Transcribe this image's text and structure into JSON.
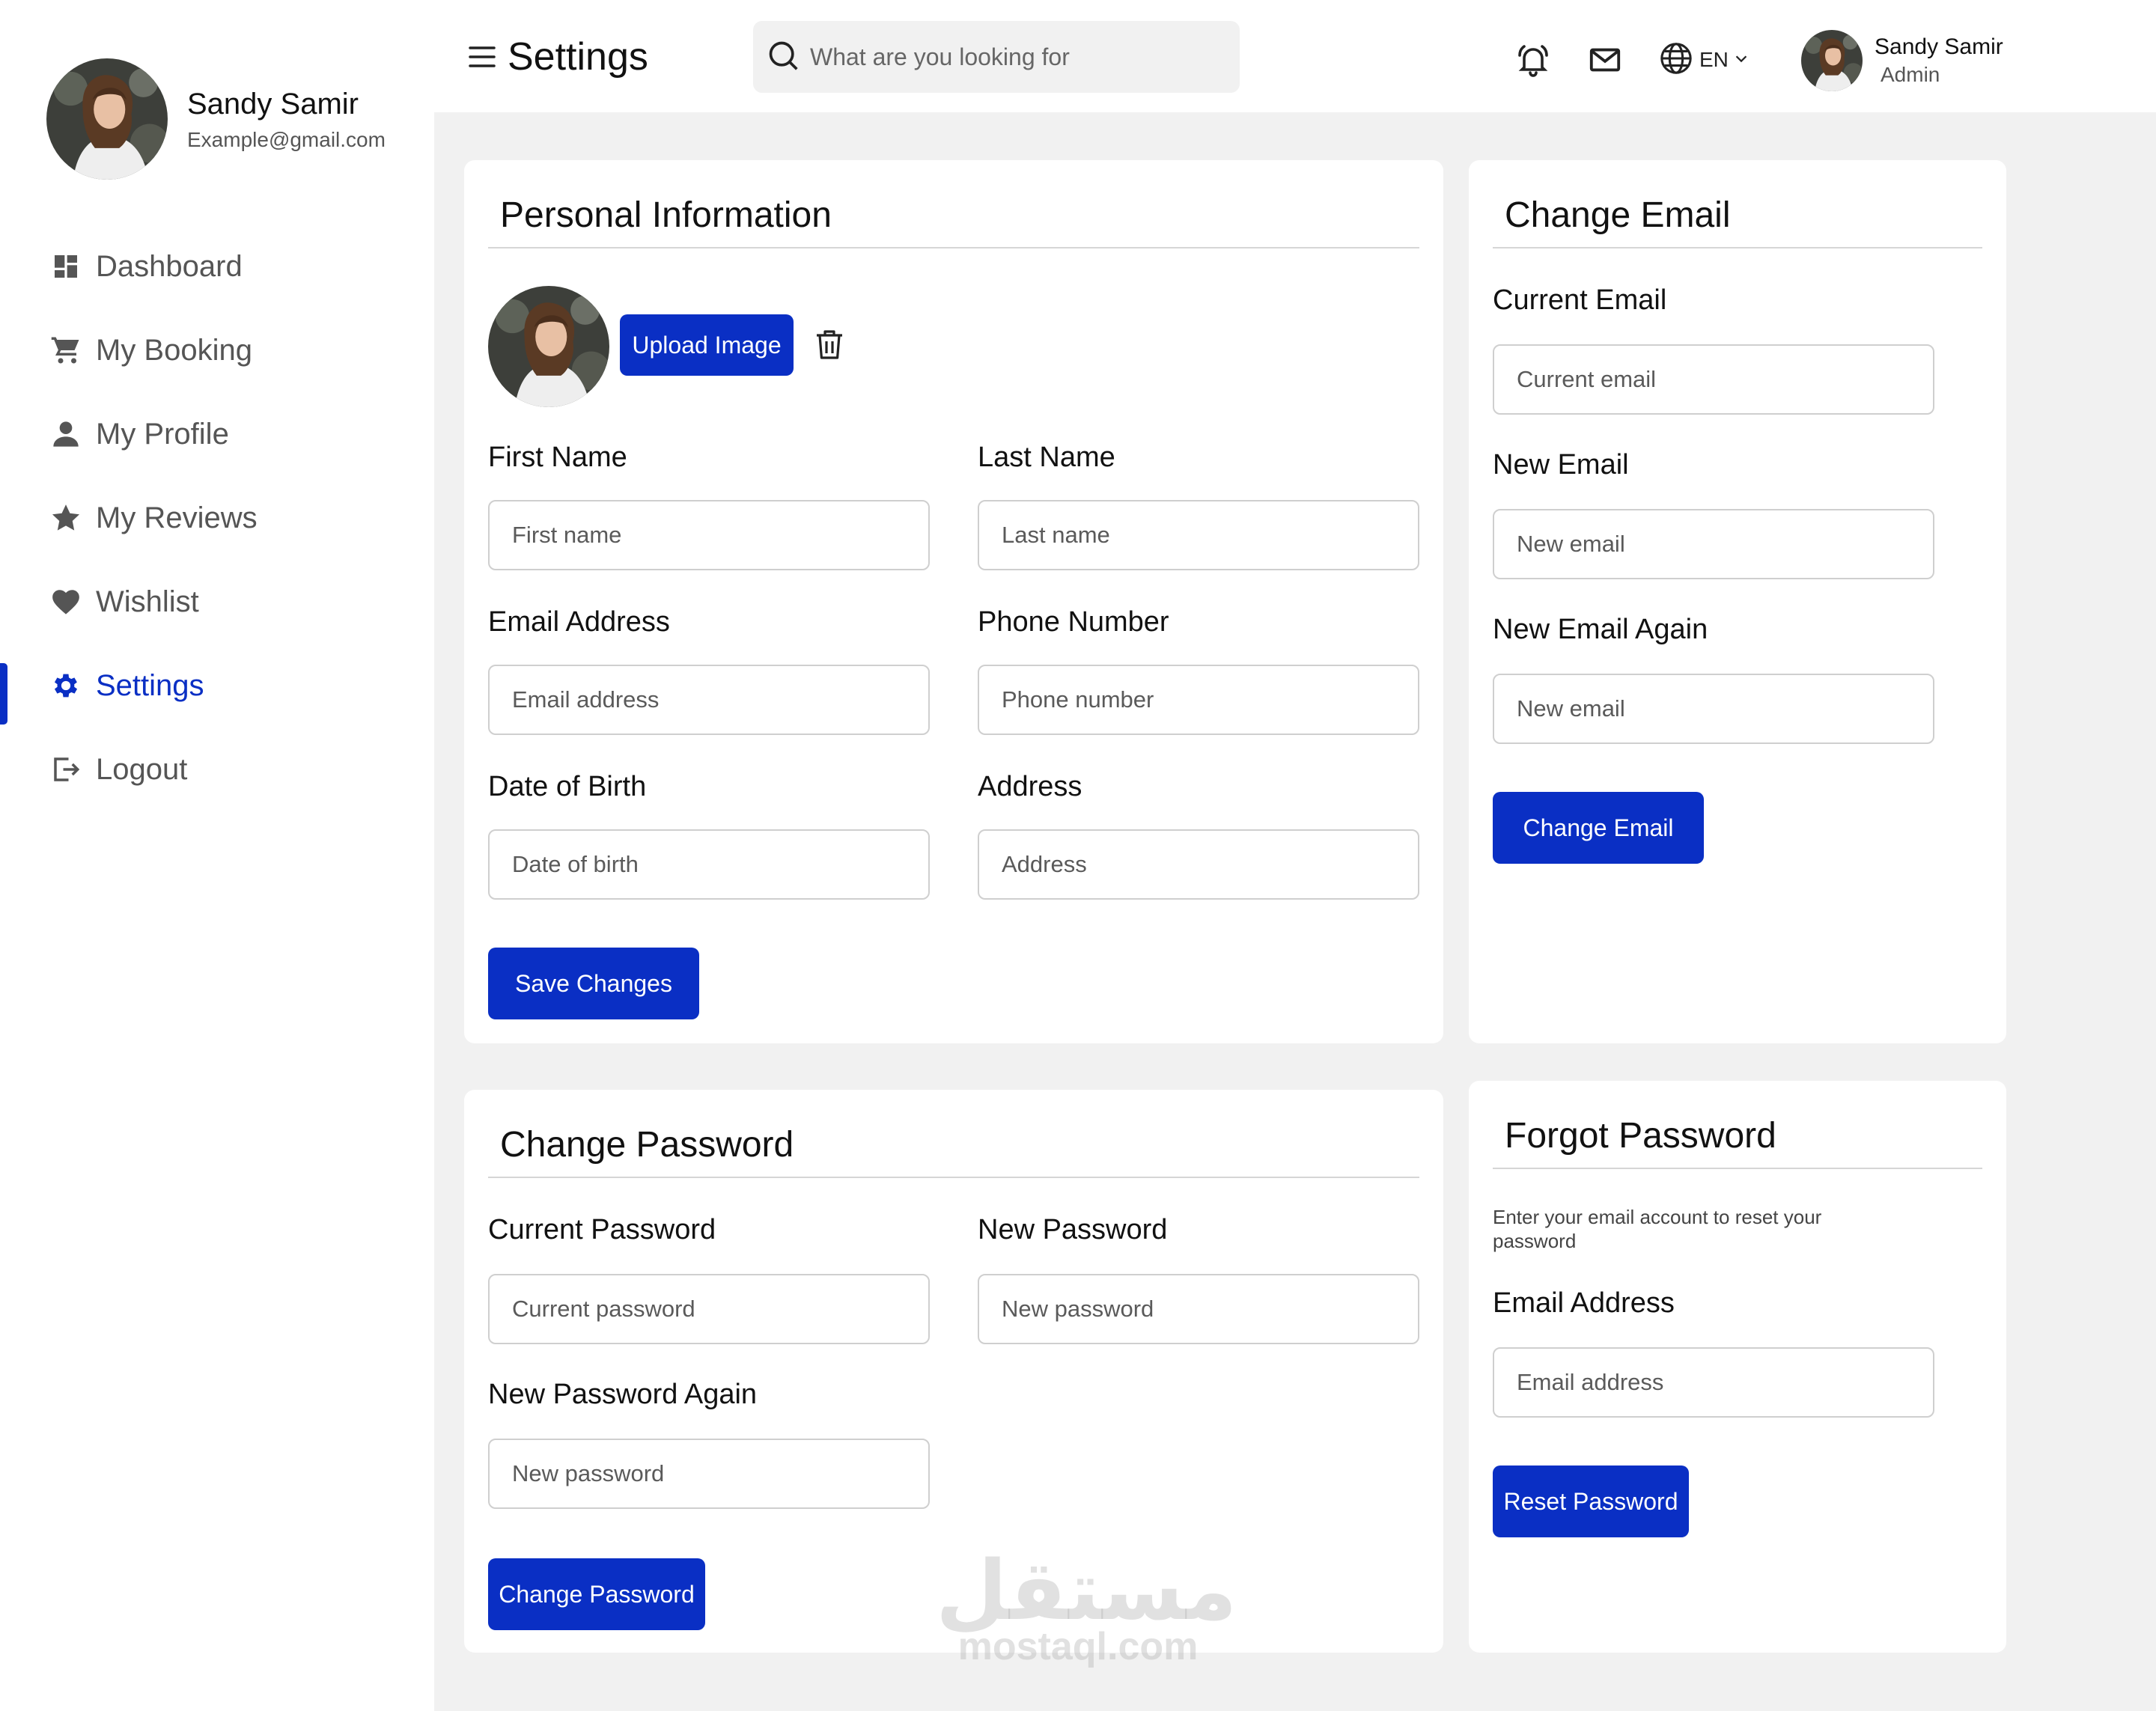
{
  "sidebar": {
    "profile": {
      "name": "Sandy Samir",
      "email": "Example@gmail.com"
    },
    "items": [
      {
        "label": "Dashboard",
        "icon": "dashboard-icon"
      },
      {
        "label": "My Booking",
        "icon": "cart-icon"
      },
      {
        "label": "My Profile",
        "icon": "user-icon"
      },
      {
        "label": "My Reviews",
        "icon": "star-icon"
      },
      {
        "label": "Wishlist",
        "icon": "heart-icon"
      },
      {
        "label": "Settings",
        "icon": "gear-icon",
        "active": true
      },
      {
        "label": "Logout",
        "icon": "logout-icon"
      }
    ]
  },
  "header": {
    "title": "Settings",
    "search_placeholder": "What are you looking for",
    "language": "EN",
    "user": {
      "name": "Sandy Samir",
      "role": "Admin"
    }
  },
  "personal_info": {
    "title": "Personal Information",
    "upload_label": "Upload Image",
    "first_name": {
      "label": "First Name",
      "placeholder": "First name"
    },
    "last_name": {
      "label": "Last Name",
      "placeholder": "Last name"
    },
    "email": {
      "label": "Email Address",
      "placeholder": "Email address"
    },
    "phone": {
      "label": "Phone Number",
      "placeholder": "Phone number"
    },
    "dob": {
      "label": "Date of Birth",
      "placeholder": "Date of birth"
    },
    "address": {
      "label": "Address",
      "placeholder": "Address"
    },
    "save_label": "Save Changes"
  },
  "change_email": {
    "title": "Change Email",
    "current": {
      "label": "Current Email",
      "placeholder": "Current email"
    },
    "new": {
      "label": "New Email",
      "placeholder": "New email"
    },
    "new_again": {
      "label": "New Email Again",
      "placeholder": "New email"
    },
    "button_label": "Change Email"
  },
  "change_password": {
    "title": "Change Password",
    "current": {
      "label": "Current Password",
      "placeholder": "Current password"
    },
    "new": {
      "label": "New Password",
      "placeholder": "New password"
    },
    "new_again": {
      "label": "New Password Again",
      "placeholder": "New password"
    },
    "button_label": "Change Password"
  },
  "forgot_password": {
    "title": "Forgot Password",
    "hint": "Enter your email account to reset your password",
    "email": {
      "label": "Email Address",
      "placeholder": "Email address"
    },
    "button_label": "Reset Password"
  },
  "watermark": {
    "arabic": "مستقل",
    "latin": "mostaql.com"
  },
  "colors": {
    "accent": "#0a2fc4",
    "background": "#f1f1f1",
    "card": "#ffffff"
  }
}
